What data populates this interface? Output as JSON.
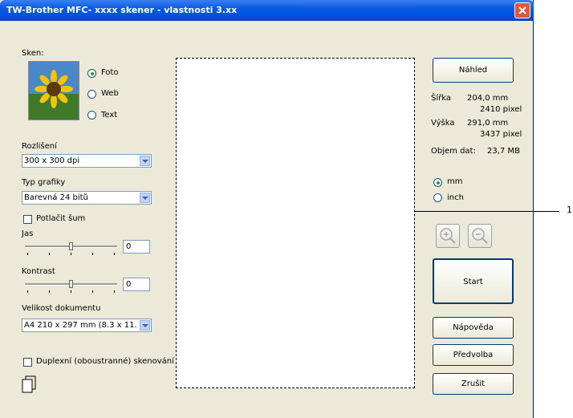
{
  "window": {
    "title": "TW-Brother MFC- xxxx skener - vlastnosti   3.xx"
  },
  "scan": {
    "label": "Sken:",
    "options": [
      "Foto",
      "Web",
      "Text"
    ],
    "selected": "Foto"
  },
  "resolution": {
    "label": "Rozlišení",
    "value": "300 x 300 dpi"
  },
  "scan_type": {
    "label": "Typ grafiky",
    "value": "Barevná 24 bitů"
  },
  "noise": {
    "label": "Potlačit šum",
    "checked": false
  },
  "brightness": {
    "label": "Jas",
    "value": "0"
  },
  "contrast": {
    "label": "Kontrast",
    "value": "0"
  },
  "doc_size": {
    "label": "Velikost dokumentu",
    "value": "A4 210 x 297 mm (8.3 x 11."
  },
  "duplex": {
    "label": "Duplexní (oboustranné) skenování",
    "checked": false
  },
  "buttons": {
    "preview": "Náhled",
    "start": "Start",
    "help": "Nápověda",
    "defaults": "Předvolba",
    "cancel": "Zrušit"
  },
  "info": {
    "width_label": "Šířka",
    "width_mm": "204,0 mm",
    "width_px": "2410 pixel",
    "height_label": "Výška",
    "height_mm": "291,0 mm",
    "height_px": "3437 pixel",
    "size_label": "Objem dat:",
    "size_value": "23,7 MB"
  },
  "units": {
    "options": [
      "mm",
      "inch"
    ],
    "selected": "mm"
  },
  "callout": "1"
}
